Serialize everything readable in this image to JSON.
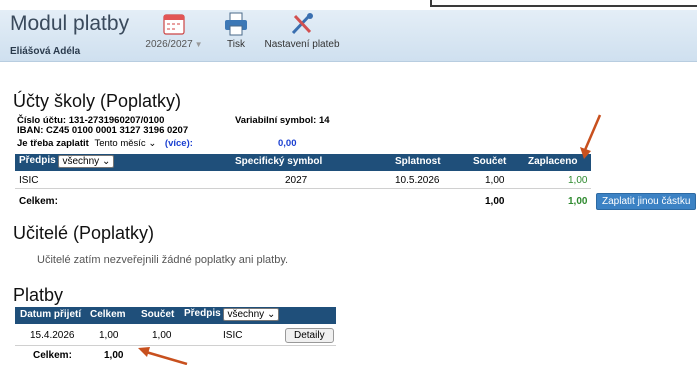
{
  "header": {
    "title": "Modul platby",
    "user": "Eliášová Adéla",
    "year": "2026/2027",
    "print_label": "Tisk",
    "settings_label": "Nastavení plateb"
  },
  "school": {
    "heading": "Účty školy (Poplatky)",
    "account_label": "Číslo účtu:",
    "account": "131-2731960207/0100",
    "iban_label": "IBAN:",
    "iban": "CZ45 0100 0001 3127 3196 0207",
    "variable_label": "Variabilní symbol:",
    "variable": "14",
    "to_pay_label": "Je třeba zaplatit",
    "period": "Tento měsíc",
    "more_open": "(",
    "more": "více",
    "more_close": "):",
    "amount": "0,00",
    "columns": {
      "predpis": "Předpis",
      "filter": "všechny",
      "symbol": "Specifický symbol",
      "due": "Splatnost",
      "sum": "Součet",
      "paid": "Zaplaceno"
    },
    "rows": [
      {
        "name": "ISIC",
        "symbol": "2027",
        "due": "10.5.2026",
        "sum": "1,00",
        "paid": "1,00"
      }
    ],
    "total_label": "Celkem:",
    "total_sum": "1,00",
    "total_paid": "1,00",
    "pay_other_button": "Zaplatit jinou částku"
  },
  "teachers": {
    "heading": "Učitelé (Poplatky)",
    "empty": "Učitelé zatím nezveřejnili žádné poplatky ani platby."
  },
  "payments": {
    "heading": "Platby",
    "columns": {
      "date": "Datum přijetí",
      "total": "Celkem",
      "sum": "Součet",
      "predpis": "Předpis",
      "filter": "všechny"
    },
    "rows": [
      {
        "date": "15.4.2026",
        "total": "1,00",
        "sum": "1,00",
        "predpis": "ISIC",
        "details": "Detaily"
      }
    ],
    "total_label": "Celkem:",
    "total": "1,00"
  },
  "colors": {
    "header_bar": "#1f4f7a",
    "paid_green": "#2f8a2f",
    "link_blue": "#1a3fd1",
    "button_blue": "#3c82c4",
    "annotation_arrow": "#c8501e"
  }
}
